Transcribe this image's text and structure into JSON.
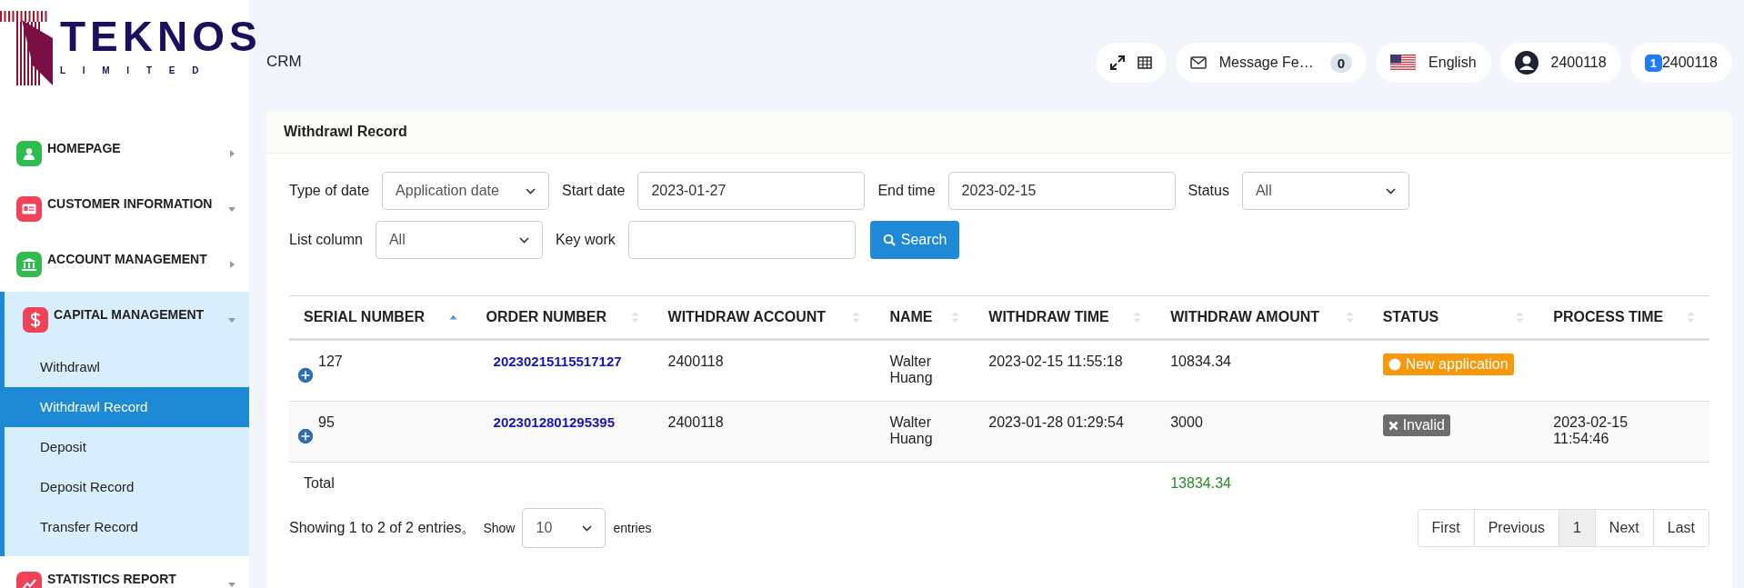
{
  "logo": {
    "name": "TEKNOS",
    "subtitle": "L I M I T E D"
  },
  "header": {
    "title": "CRM",
    "messages": {
      "label": "Message Fe…",
      "count": "0"
    },
    "language": "English",
    "user": "2400118",
    "account": {
      "badge": "1",
      "label": "2400118"
    }
  },
  "sidebar": {
    "items": [
      {
        "label": "HOMEPAGE",
        "kind": "user",
        "color": "#2ebd4e",
        "expanded": false
      },
      {
        "label": "CUSTOMER INFORMATION",
        "kind": "card",
        "color": "#f0435a",
        "expanded": false
      },
      {
        "label": "ACCOUNT MANAGEMENT",
        "kind": "bank",
        "color": "#2ebd4e",
        "expanded": false
      },
      {
        "label": "CAPITAL MANAGEMENT",
        "kind": "dollar",
        "color": "#f0435a",
        "expanded": true,
        "children": [
          {
            "label": "Withdrawl",
            "selected": false
          },
          {
            "label": "Withdrawl Record",
            "selected": true
          },
          {
            "label": "Deposit",
            "selected": false
          },
          {
            "label": "Deposit Record",
            "selected": false
          },
          {
            "label": "Transfer Record",
            "selected": false
          }
        ]
      },
      {
        "label": "STATISTICS REPORT",
        "kind": "chart",
        "color": "#f0435a",
        "expanded": false
      }
    ]
  },
  "panel": {
    "title": "Withdrawl Record",
    "filters": [
      {
        "label": "Type of date",
        "kind": "select",
        "value": "Application date"
      },
      {
        "label": "Start date",
        "kind": "input",
        "value": "2023-01-27"
      },
      {
        "label": "End time",
        "kind": "input",
        "value": "2023-02-15"
      },
      {
        "label": "Status",
        "kind": "select",
        "value": "All"
      },
      {
        "label": "List column",
        "kind": "select",
        "value": "All"
      },
      {
        "label": "Key work",
        "kind": "input"
      }
    ],
    "search_button": "Search",
    "table": {
      "columns": [
        {
          "label": "SERIAL NUMBER",
          "sorted": true
        },
        {
          "label": "ORDER NUMBER",
          "sorted": false
        },
        {
          "label": "WITHDRAW ACCOUNT",
          "sorted": false
        },
        {
          "label": "NAME",
          "sorted": false
        },
        {
          "label": "WITHDRAW TIME",
          "sorted": false
        },
        {
          "label": "WITHDRAW AMOUNT",
          "sorted": false
        },
        {
          "label": "STATUS",
          "sorted": false
        },
        {
          "label": "PROCESS TIME",
          "sorted": false
        }
      ],
      "rows": [
        {
          "serial": "127",
          "order": "20230215115517127",
          "account": "2400118",
          "name": "Walter Huang",
          "time": "2023-02-15 11:55:18",
          "amount": "10834.34",
          "status": {
            "label": "New application",
            "kind": "new"
          }
        },
        {
          "serial": "95",
          "order": "2023012801295395",
          "account": "2400118",
          "name": "Walter Huang",
          "time": "2023-01-28 01:29:54",
          "amount": "3000",
          "status": {
            "label": "Invalid",
            "kind": "invalid"
          },
          "process_time": "2023-02-15 11:54:46"
        }
      ],
      "total": {
        "label": "Total",
        "amount": "13834.34"
      }
    },
    "footer": {
      "info": "Showing 1 to 2 of 2 entries。",
      "show": "Show",
      "page_size": "10",
      "entries": "entries",
      "pages": [
        {
          "label": "First",
          "selected": false
        },
        {
          "label": "Previous",
          "selected": false
        },
        {
          "label": "1",
          "selected": true
        },
        {
          "label": "Next",
          "selected": false
        },
        {
          "label": "Last",
          "selected": false
        }
      ]
    }
  }
}
